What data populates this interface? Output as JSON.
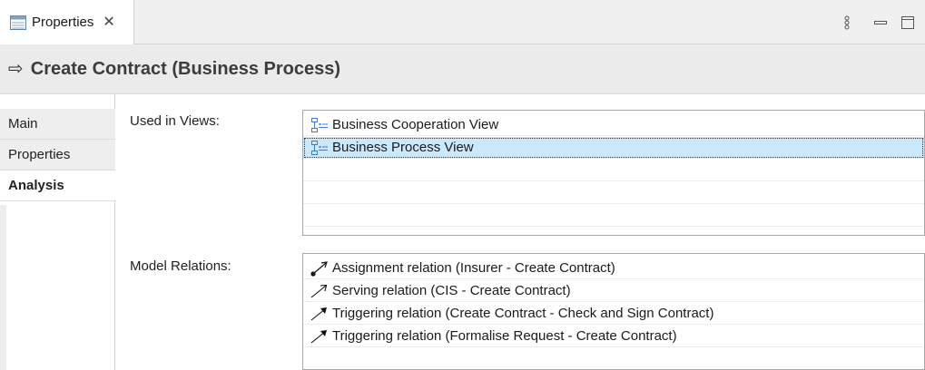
{
  "tab": {
    "label": "Properties",
    "close": "✕",
    "icon": "properties-view-icon"
  },
  "toolbar": {
    "icons": [
      "view-menu-icon",
      "minimize-icon",
      "maximize-icon"
    ]
  },
  "header": {
    "arrow": "⇨",
    "title": "Create Contract (Business Process)"
  },
  "sidebar": {
    "items": [
      {
        "label": "Main",
        "active": false
      },
      {
        "label": "Properties",
        "active": false
      },
      {
        "label": "Analysis",
        "active": true
      }
    ]
  },
  "used_in_views": {
    "label": "Used in Views:",
    "items": [
      {
        "label": "Business Cooperation View",
        "icon": "diagram-view-icon",
        "selected": false
      },
      {
        "label": "Business Process View",
        "icon": "diagram-view-icon",
        "selected": true
      }
    ]
  },
  "model_relations": {
    "label": "Model Relations:",
    "items": [
      {
        "label": "Assignment relation (Insurer - Create Contract)",
        "icon": "assignment-relation-icon"
      },
      {
        "label": "Serving relation (CIS - Create Contract)",
        "icon": "serving-relation-icon"
      },
      {
        "label": "Triggering relation (Create Contract - Check and  Sign Contract)",
        "icon": "triggering-relation-icon"
      },
      {
        "label": "Triggering relation (Formalise Request - Create Contract)",
        "icon": "triggering-relation-icon"
      }
    ]
  },
  "colors": {
    "selection": "#cce8ff",
    "header_bg": "#ebebeb",
    "diagram_icon": "#3a7bd5"
  }
}
